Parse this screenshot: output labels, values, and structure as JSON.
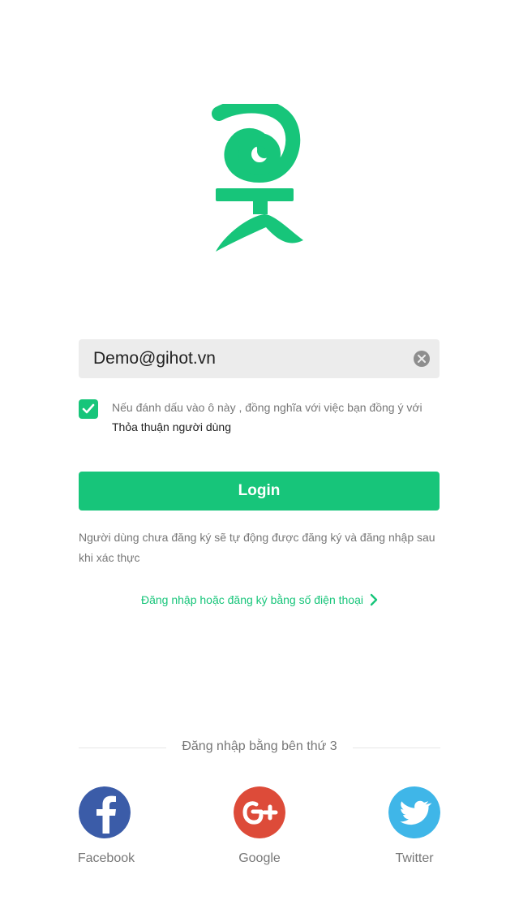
{
  "brand": {
    "color": "#17c57a"
  },
  "form": {
    "email_value": "Demo@gihot.vn",
    "agree_checked": true,
    "agree_text": "Nếu đánh dấu vào ô này , đồng nghĩa với việc bạn đồng ý với",
    "agree_link": "Thỏa thuận người dùng",
    "login_label": "Login",
    "auto_register_note": "Người dùng chưa đăng ký sẽ tự động được đăng ký và đăng nhập sau khi xác thực",
    "phone_login_link": "Đăng nhập hoặc đăng ký bằng số điện thoại"
  },
  "third_party": {
    "label": "Đăng nhập bằng bên thứ 3",
    "providers": [
      {
        "name": "Facebook",
        "icon": "facebook-icon",
        "color": "#3b5ca8"
      },
      {
        "name": "Google",
        "icon": "google-plus-icon",
        "color": "#dd4b39"
      },
      {
        "name": "Twitter",
        "icon": "twitter-icon",
        "color": "#3fb6e8"
      }
    ]
  }
}
